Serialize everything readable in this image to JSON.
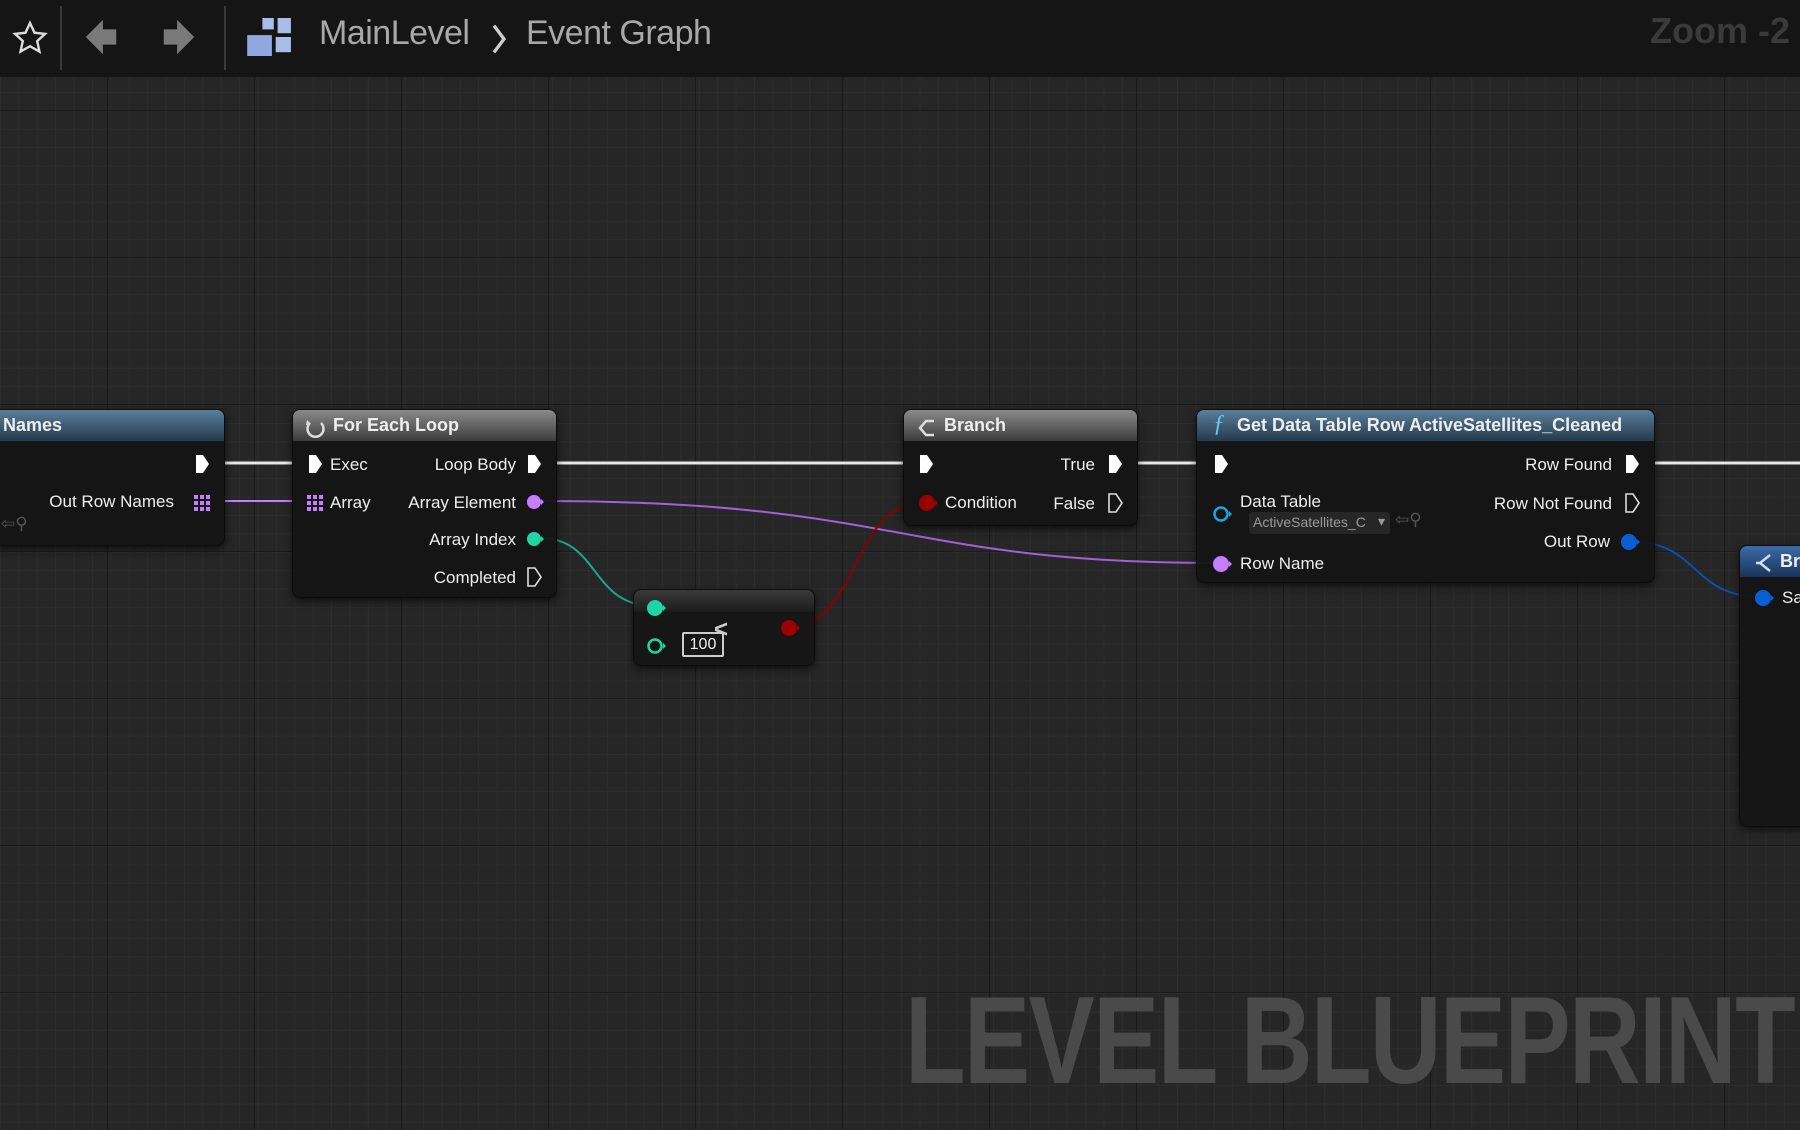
{
  "toolbar": {
    "breadcrumb": [
      "MainLevel",
      "Event Graph"
    ],
    "zoom": "Zoom -2",
    "icons": [
      "star-icon",
      "back-arrow-icon",
      "forward-arrow-icon",
      "graph-hierarchy-icon",
      "chevron-right-icon"
    ]
  },
  "nodes": {
    "get_names": {
      "title": "Names",
      "out_row_names": "Out Row Names"
    },
    "for_each": {
      "title": "For Each Loop",
      "exec": "Exec",
      "array": "Array",
      "loop_body": "Loop Body",
      "array_element": "Array Element",
      "array_index": "Array Index",
      "completed": "Completed"
    },
    "compare": {
      "operator": "<",
      "value": "100"
    },
    "branch": {
      "title": "Branch",
      "condition": "Condition",
      "true": "True",
      "false": "False"
    },
    "get_row": {
      "title": "Get Data Table Row ActiveSatellites_Cleaned",
      "data_table": "Data Table",
      "data_table_value": "ActiveSatellites_C",
      "row_name": "Row Name",
      "row_found": "Row Found",
      "row_not_found": "Row Not Found",
      "out_row": "Out Row"
    },
    "break": {
      "title": "Br",
      "pin": "Sa"
    }
  },
  "colors": {
    "exec": "#ffffff",
    "name_pin": "#c77dff",
    "int_pin": "#1ed6a2",
    "bool_pin": "#9b0000",
    "struct_pin": "#0a5fd6",
    "object_pin": "#1aa3e0"
  },
  "watermark": "LEVEL BLUEPRINT"
}
